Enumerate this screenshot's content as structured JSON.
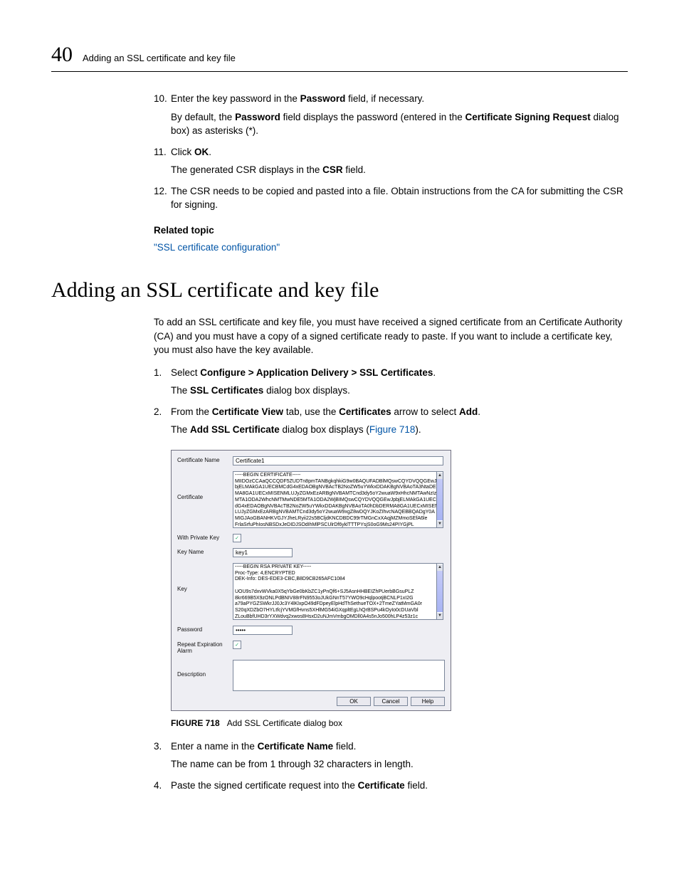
{
  "header": {
    "pageNumber": "40",
    "title": "Adding an SSL certificate and key file"
  },
  "steps_a": {
    "s10_num": "10.",
    "s10_text_1": "Enter the key password in the ",
    "s10_bold_1": "Password",
    "s10_text_2": " field, if necessary.",
    "s10_sub_1": "By default, the ",
    "s10_sub_b1": "Password",
    "s10_sub_2": " field displays the password (entered in the ",
    "s10_sub_b2": "Certificate Signing Request",
    "s10_sub_3": " dialog box) as asterisks (*).",
    "s11_num": "11.",
    "s11_text_1": "Click ",
    "s11_bold_1": "OK",
    "s11_text_2": ".",
    "s11_sub_1": "The generated CSR displays in the ",
    "s11_sub_b1": "CSR",
    "s11_sub_2": " field.",
    "s12_num": "12.",
    "s12_text": "The CSR needs to be copied and pasted into a file. Obtain instructions from the CA for submitting the CSR for signing."
  },
  "related": {
    "heading": "Related topic",
    "link": "\"SSL certificate configuration\""
  },
  "main": {
    "heading": "Adding an SSL certificate and key file",
    "intro": "To add an SSL certificate and key file, you must have received a signed certificate from an Certificate Authority (CA) and you must have a copy of a signed certificate ready to paste. If you want to include a certificate key, you must also have the key available.",
    "s1_num": "1.",
    "s1_text_1": "Select ",
    "s1_bold": "Configure > Application Delivery > SSL Certificates",
    "s1_text_2": ".",
    "s1_sub_1": "The ",
    "s1_sub_b": "SSL Certificates",
    "s1_sub_2": " dialog box displays.",
    "s2_num": "2.",
    "s2_text_1": "From the ",
    "s2_bold_1": "Certificate View",
    "s2_text_2": " tab, use the ",
    "s2_bold_2": "Certificates",
    "s2_text_3": " arrow to select ",
    "s2_bold_3": "Add",
    "s2_text_4": ".",
    "s2_sub_1": "The ",
    "s2_sub_b": "Add SSL Certificate",
    "s2_sub_2": " dialog box displays (",
    "s2_sub_link": "Figure 718",
    "s2_sub_3": ").",
    "s3_num": "3.",
    "s3_text_1": "Enter a name in the ",
    "s3_bold": "Certificate Name",
    "s3_text_2": " field.",
    "s3_sub": "The name can be from 1 through 32 characters in length.",
    "s4_num": "4.",
    "s4_text_1": "Paste the signed certificate request into the ",
    "s4_bold": "Certificate",
    "s4_text_2": " field."
  },
  "dialog": {
    "labels": {
      "certName": "Certificate Name",
      "certificate": "Certificate",
      "withPriv": "With Private Key",
      "keyName": "Key Name",
      "key": "Key",
      "password": "Password",
      "repeat": "Repeat Expiration Alarm",
      "description": "Description"
    },
    "values": {
      "certName": "Certificate1",
      "certBody": "-----BEGIN CERTIFICATE-----\nMIIDOzCCAaQCCQDF5ZUDTn8pmTANBgkqhkiG9w0BAQUFADBlMQswCQYDVQQGEwJp\nbjELMAkGA1UECBMCdG4xEDAOBgNVBAcTB2NoZW5uYWkxDDAKBgNVBAoTA3NtaDER\nMA8GA1UECxMISENMLUJyZGMxEzARBgNVBAMTCnd3dy5oY2wuaW9xHhcNMTAwNzIz\nMTA1ODA2WhcNMTMwNDE5MTA1ODA2WjBIMQswCQYDVQQGEwJpbjELMAkGA1UECBMC\ndG4xEDAOBgNVBAcTB2NoZW5uYWkxDDAKBgNVBAoTA0hDbDERMA8GA1UECxMISENM\nLUJyZGMxEzARBgNVBAMTCnd3dy5oY2wuaW9xgZ8wDQYJKoZIhvcNAQEBBQADgY0A\nMIGJAoGBANHKVGJYJheLRyii22s5BCljdKNCDBDC99rTMGnCxXAqjMZMmoSEfA6le\nFrlaSrfuPhIosNBSDxJeDIDJSOdIhMlPSCUlrDf6yklTTTPYsjS0oG9Ms24PIYGjPL",
      "keyName": "key1",
      "keyBody": "-----BEGIN RSA PRIVATE KEY-----\nProc-Type: 4,ENCRYPTED\nDEK-Info: DES-EDE3-CBC,B8D9CB265AFC1084\n\nUOU9s7dxvWVka0X5qYbGe0bKbZC1yPnQf6+SJ5AsnHHBEIZhPUerbBGsuPLZ\n8kr669B5X9zONLPdBNIV88rFN9553oJUkGNnT57YWO9cHqlpootjBCNLP1xI2G\na79aPYGZSWkrJJ0Jc3Y4lKlxpO49dFDpeyElpHdThSethueTOX+2TmeZYatMmGA0r\nS20qXDZbO7HYLtfcjYVMGfHvns5XHlMG54iGXqpltEgLhQrBSPu4kOyIo0cDUaVbl\nZLouBbfUHD3rYXWdvq2xwos8HsxD2uNJmVmbgOMDll0A4s5nJo500hLP4z53z1c",
      "password": "•••••",
      "check": "✓"
    },
    "buttons": {
      "ok": "OK",
      "cancel": "Cancel",
      "help": "Help"
    }
  },
  "figure": {
    "label": "FIGURE 718",
    "caption": "Add SSL Certificate dialog box"
  }
}
